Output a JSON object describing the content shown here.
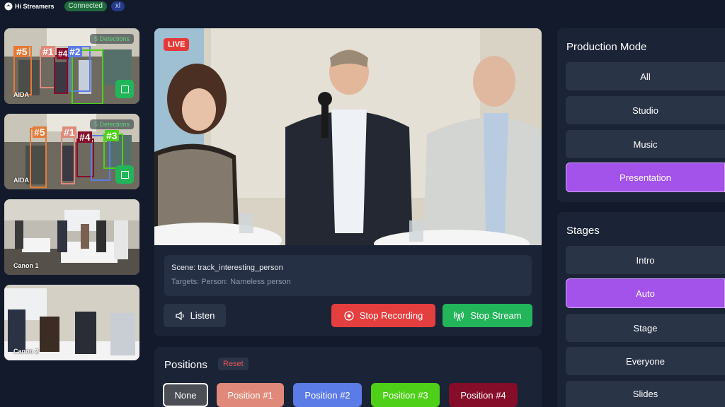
{
  "app": {
    "name": "Hi Streamers",
    "status": "Connected",
    "size": "xl"
  },
  "cameras": [
    {
      "label": "AIDA",
      "detections": "5 Detections"
    },
    {
      "label": "AIDA",
      "detections": "5 Detections"
    },
    {
      "label": "Canon 1"
    },
    {
      "label": "Canon 2"
    }
  ],
  "thumb1_tags": [
    "#5",
    "#1",
    "#4",
    "#2"
  ],
  "thumb2_tags": [
    "#5",
    "#1",
    "#4",
    "#3"
  ],
  "video": {
    "live_label": "LIVE"
  },
  "scene": {
    "scene_text": "Scene: track_interesting_person",
    "targets_text": "Targets: Person: Nameless person"
  },
  "controls": {
    "listen": "Listen",
    "stop_recording": "Stop Recording",
    "stop_stream": "Stop Stream"
  },
  "positions": {
    "title": "Positions",
    "reset": "Reset",
    "items": [
      {
        "label": "None",
        "color": "#4b4e55"
      },
      {
        "label": "Position #1",
        "color": "#e0897a"
      },
      {
        "label": "Position #2",
        "color": "#5b7be6"
      },
      {
        "label": "Position #3",
        "color": "#4fd018"
      },
      {
        "label": "Position #4",
        "color": "#850d2a"
      }
    ]
  },
  "production_mode": {
    "title": "Production Mode",
    "items": [
      "All",
      "Studio",
      "Music",
      "Presentation"
    ],
    "active": "Presentation"
  },
  "stages": {
    "title": "Stages",
    "items": [
      "Intro",
      "Auto",
      "Stage",
      "Everyone",
      "Slides"
    ],
    "active": "Auto"
  },
  "colors": {
    "accent": "#a352ea",
    "live": "#e53939",
    "stream": "#22b55a",
    "record": "#e53e3e"
  }
}
